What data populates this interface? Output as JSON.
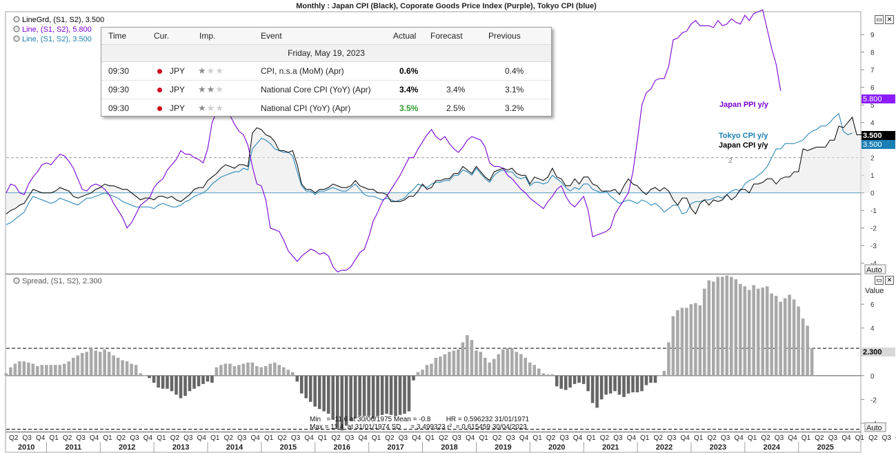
{
  "title": "Monthly : Japan CPI (Black), Coporate Goods Price Index (Purple), Tokyo CPI (blue)",
  "top_legend": [
    {
      "label": "LineGrd, (S1, S2), 3.500",
      "color": "#000000"
    },
    {
      "label": "Line, (S1, S2), 5.800",
      "color": "#7b00d6"
    },
    {
      "label": "Line, (S1, S2), 3.500",
      "color": "#1a7fb5"
    }
  ],
  "bottom_legend": "Spread, (S1, S2), 2.300",
  "value_label": "Value",
  "auto_label": "Auto",
  "series_labels": {
    "ppi": "Japan PPI y/y",
    "tokyo": "Tokyo CPI y/y",
    "japan": "Japan CPI y/y"
  },
  "badges": {
    "ppi": "5.800",
    "japan": "3.500",
    "tokyo": "3.500",
    "spread": "2.300"
  },
  "hline_label": "2",
  "stats": {
    "line1": "Min   = -11.6 at 30/06/1975 Mean = -0.8        HR = 0.596232 31/01/1971",
    "line2": "Max = 11.4  at 31/01/1974 SD     = 3.499323 r²  = 0.615459 30/04/2023"
  },
  "calendar": {
    "headers": [
      "Time",
      "Cur.",
      "Imp.",
      "Event",
      "Actual",
      "Forecast",
      "Previous"
    ],
    "date": "Friday, May 19, 2023",
    "rows": [
      {
        "time": "09:30",
        "cur": "JPY",
        "stars": 1,
        "event": "CPI, n.s.a (MoM) (Apr)",
        "actual": "0.6%",
        "actual_color": "#000000",
        "forecast": "",
        "previous": "0.4%"
      },
      {
        "time": "09:30",
        "cur": "JPY",
        "stars": 2,
        "event": "National Core CPI (YoY) (Apr)",
        "actual": "3.4%",
        "actual_color": "#000000",
        "forecast": "3.4%",
        "previous": "3.1%"
      },
      {
        "time": "09:30",
        "cur": "JPY",
        "stars": 1,
        "event": "National CPI (YoY) (Apr)",
        "actual": "3.5%",
        "actual_color": "#2e9e2e",
        "forecast": "2.5%",
        "previous": "3.2%"
      }
    ]
  },
  "colors": {
    "japan": "#000000",
    "ppi": "#7b00d6",
    "tokyo": "#1a7fb5",
    "bar": "#a9a9a9",
    "bar_neg": "#666666",
    "ppi_badge": "#8a1cff",
    "tokyo_badge": "#1a7fb5"
  },
  "chart_data": [
    {
      "type": "line",
      "y_ticks": [
        -4,
        -3,
        -2,
        -1,
        0,
        1,
        2,
        3,
        4,
        5,
        6,
        7,
        8,
        9
      ],
      "ylim": [
        -4.6,
        10.3
      ],
      "x_start": "2010-04",
      "series": [
        {
          "name": "Japan CPI y/y",
          "values": [
            -1.2,
            -1.0,
            -0.9,
            -0.7,
            -0.6,
            -0.2,
            0.2,
            0.1,
            0.0,
            0.0,
            0.0,
            0.1,
            0.3,
            0.2,
            0.1,
            -0.2,
            -0.3,
            -0.2,
            -0.1,
            0.0,
            0.2,
            0.3,
            0.5,
            0.4,
            0.4,
            0.3,
            0.2,
            0.2,
            0.0,
            -0.2,
            -0.4,
            -0.3,
            -0.3,
            -0.4,
            -0.2,
            -0.2,
            -0.3,
            -0.2,
            -0.4,
            -0.5,
            -0.3,
            -0.1,
            0.2,
            0.3,
            0.3,
            0.7,
            0.9,
            1.1,
            1.4,
            1.6,
            1.5,
            1.4,
            1.6,
            1.6,
            1.5,
            3.4,
            3.7,
            3.6,
            3.3,
            3.2,
            2.9,
            2.4,
            2.4,
            2.3,
            2.4,
            1.6,
            0.5,
            0.2,
            0.2,
            0.0,
            0.2,
            0.2,
            0.3,
            0.5,
            0.4,
            0.3,
            0.3,
            0.4,
            0.7,
            0.4,
            0.3,
            0.2,
            0.2,
            0.0,
            0.0,
            -0.1,
            -0.5,
            -0.5,
            -0.5,
            -0.4,
            -0.2,
            -0.2,
            0.1,
            0.5,
            0.2,
            0.3,
            0.7,
            0.7,
            0.8,
            0.8,
            1.1,
            1.1,
            1.5,
            1.3,
            1.1,
            1.5,
            1.2,
            0.9,
            0.7,
            1.2,
            1.3,
            1.4,
            1.3,
            1.4,
            1.1,
            1.0,
            1.0,
            0.5,
            0.9,
            0.8,
            0.7,
            0.9,
            1.4,
            0.9,
            0.8,
            0.4,
            0.4,
            0.8,
            0.5,
            0.9,
            0.9,
            0.5,
            0.4,
            0.1,
            0.1,
            0.1,
            0.2,
            -0.1,
            0.4,
            0.8,
            0.5,
            0.4,
            0.1,
            -0.1,
            0.2,
            0.3,
            0.1,
            0.3,
            0.1,
            -0.4,
            -0.7,
            -0.3,
            -0.3,
            -0.9,
            -1.2,
            -0.6,
            -0.4,
            -0.7,
            -0.4,
            -0.5,
            -0.4,
            -0.1,
            -0.4,
            -0.2,
            0.2,
            0.2,
            0.0,
            0.5,
            0.5,
            0.6,
            0.8,
            0.8,
            0.5,
            0.8,
            0.9,
            0.9,
            1.2,
            1.2,
            2.5,
            2.4,
            2.5,
            2.6,
            2.6,
            2.6,
            3.0,
            3.0,
            3.8,
            3.7,
            4.0,
            4.3,
            3.3,
            3.3,
            3.2,
            3.5
          ]
        },
        {
          "name": "Japan PPI y/y",
          "values": [
            0.0,
            0.5,
            0.4,
            0.0,
            -0.1,
            0.5,
            0.9,
            1.2,
            1.6,
            1.7,
            1.6,
            1.9,
            2.2,
            2.1,
            1.8,
            1.4,
            0.8,
            0.2,
            0.1,
            0.4,
            0.5,
            0.4,
            0.2,
            -0.1,
            -0.6,
            -1.0,
            -1.4,
            -2.0,
            -1.7,
            -1.2,
            -0.7,
            -0.5,
            -0.3,
            0.3,
            0.6,
            0.8,
            1.3,
            1.6,
            1.9,
            2.4,
            2.2,
            2.2,
            2.0,
            1.9,
            1.7,
            2.5,
            4.0,
            4.6,
            4.6,
            4.5,
            4.4,
            3.9,
            3.5,
            3.3,
            2.7,
            1.5,
            0.5,
            0.4,
            -0.4,
            -2.0,
            -2.1,
            -2.2,
            -2.7,
            -3.3,
            -3.6,
            -3.9,
            -3.6,
            -3.4,
            -3.2,
            -3.3,
            -3.5,
            -3.4,
            -3.6,
            -4.2,
            -4.5,
            -4.4,
            -4.4,
            -4.2,
            -3.8,
            -3.4,
            -3.2,
            -2.5,
            -1.6,
            -1.1,
            -0.5,
            -0.2,
            0.2,
            0.6,
            1.0,
            1.5,
            2.0,
            2.0,
            2.5,
            2.9,
            3.3,
            3.6,
            3.2,
            3.0,
            3.2,
            2.8,
            2.5,
            2.3,
            2.6,
            3.0,
            3.2,
            3.1,
            3.0,
            2.6,
            1.7,
            1.5,
            1.5,
            1.4,
            1.0,
            0.8,
            0.5,
            0.2,
            0.0,
            -0.3,
            -0.5,
            -0.7,
            -0.9,
            -0.5,
            -0.2,
            0.2,
            0.4,
            -0.2,
            -0.6,
            -0.8,
            -0.5,
            -0.2,
            -1.0,
            -2.5,
            -2.4,
            -2.3,
            -2.2,
            -2.0,
            -1.2,
            -0.8,
            -0.4,
            0.0,
            1.2,
            3.0,
            5.0,
            5.7,
            5.9,
            6.4,
            6.5,
            6.5,
            7.2,
            8.7,
            8.8,
            9.1,
            9.2,
            9.6,
            9.8,
            9.5,
            9.5,
            9.5,
            9.4,
            9.8,
            9.5,
            9.6,
            9.9,
            9.7,
            9.6,
            10.1,
            9.8,
            10.2,
            10.3,
            10.4,
            9.3,
            8.2,
            7.3,
            5.8
          ]
        },
        {
          "name": "Tokyo CPI y/y",
          "values": [
            -1.8,
            -1.7,
            -1.5,
            -1.3,
            -1.1,
            -0.6,
            -0.2,
            -0.3,
            -0.4,
            -0.5,
            -0.6,
            -0.5,
            -0.3,
            -0.4,
            -0.5,
            -0.6,
            -0.7,
            -0.5,
            -0.3,
            -0.3,
            -0.2,
            -0.1,
            0.0,
            -0.1,
            -0.2,
            -0.3,
            -0.5,
            -0.6,
            -0.7,
            -0.8,
            -0.8,
            -0.8,
            -0.8,
            -0.9,
            -0.7,
            -0.6,
            -0.7,
            -0.8,
            -0.8,
            -0.7,
            -0.5,
            -0.4,
            -0.2,
            -0.1,
            0.0,
            0.2,
            0.5,
            0.7,
            0.9,
            1.0,
            1.1,
            1.2,
            1.2,
            1.4,
            1.3,
            2.5,
            2.8,
            3.1,
            3.0,
            2.8,
            2.5,
            2.4,
            2.3,
            2.3,
            2.1,
            1.2,
            0.4,
            0.1,
            0.1,
            -0.1,
            0.1,
            0.1,
            0.2,
            0.3,
            0.2,
            0.1,
            0.1,
            0.3,
            0.5,
            0.2,
            -0.1,
            -0.2,
            -0.2,
            -0.3,
            -0.4,
            -0.3,
            -0.4,
            -0.5,
            -0.4,
            -0.3,
            0.0,
            0.2,
            0.5,
            0.4,
            0.3,
            0.5,
            0.6,
            0.6,
            0.7,
            0.7,
            1.0,
            1.0,
            1.3,
            1.2,
            1.0,
            1.4,
            1.1,
            0.8,
            0.6,
            1.0,
            1.2,
            1.3,
            1.2,
            1.2,
            0.9,
            0.8,
            0.9,
            0.4,
            0.6,
            0.6,
            0.5,
            0.6,
            1.0,
            0.8,
            0.6,
            0.3,
            0.1,
            0.3,
            0.2,
            0.5,
            0.5,
            0.2,
            0.1,
            0.0,
            0.1,
            -0.2,
            -0.4,
            -0.6,
            -0.5,
            -0.4,
            -0.5,
            -0.6,
            -0.4,
            -0.5,
            -0.7,
            -0.6,
            -0.8,
            -1.1,
            -0.9,
            -0.7,
            -0.7,
            -1.2,
            -1.1,
            -0.6,
            -0.5,
            -0.5,
            -0.4,
            -0.4,
            -0.3,
            -0.2,
            -0.3,
            -0.1,
            0.1,
            0.2,
            0.1,
            0.5,
            0.7,
            0.8,
            1.0,
            1.2,
            1.5,
            2.0,
            2.5,
            2.5,
            2.8,
            2.8,
            2.8,
            2.9,
            3.0,
            3.3,
            3.5,
            3.6,
            3.8,
            3.8,
            4.0,
            4.3,
            4.5,
            3.5,
            3.3,
            3.4
          ]
        }
      ],
      "annotations": [
        "Japan PPI y/y",
        "Tokyo CPI y/y",
        "Japan CPI y/y"
      ]
    },
    {
      "type": "bar",
      "name": "Spread, (S1, S2)",
      "y_ticks": [
        -4,
        -2,
        0,
        2,
        4,
        6
      ],
      "ylim": [
        -4.7,
        8.5
      ],
      "x_start": "2010-04",
      "reference_line": 2.3,
      "values": [
        0.2,
        0.7,
        1.0,
        1.2,
        1.2,
        1.1,
        1.0,
        0.8,
        0.9,
        0.9,
        0.9,
        0.9,
        0.9,
        1.0,
        1.2,
        1.5,
        1.7,
        1.9,
        2.0,
        2.3,
        2.1,
        2.0,
        2.2,
        2.0,
        1.7,
        1.5,
        1.3,
        1.2,
        1.0,
        0.9,
        0.2,
        0.0,
        -0.2,
        -0.6,
        -1.0,
        -1.1,
        -1.1,
        -1.3,
        -1.6,
        -1.9,
        -1.7,
        -1.3,
        -1.1,
        -0.9,
        -0.7,
        -0.5,
        -0.6,
        0.7,
        0.9,
        1.0,
        1.0,
        0.8,
        0.9,
        1.0,
        1.1,
        1.1,
        0.8,
        0.7,
        0.8,
        1.0,
        1.1,
        0.9,
        0.7,
        0.5,
        0.3,
        -0.5,
        -1.5,
        -1.9,
        -2.2,
        -2.6,
        -2.8,
        -3.0,
        -3.2,
        -3.7,
        -4.4,
        -4.6,
        -4.2,
        -3.8,
        -3.6,
        -3.4,
        -3.4,
        -3.4,
        -3.6,
        -3.4,
        -3.3,
        -3.2,
        -3.3,
        -3.4,
        -3.3,
        -3.2,
        -3.0,
        -0.4,
        0.3,
        0.5,
        0.9,
        1.0,
        1.5,
        1.6,
        1.8,
        2.0,
        2.1,
        2.2,
        2.8,
        3.4,
        3.0,
        2.1,
        2.0,
        1.5,
        1.1,
        1.4,
        1.8,
        2.2,
        2.3,
        2.3,
        2.0,
        1.8,
        1.5,
        1.1,
        0.9,
        0.6,
        0.2,
        0.1,
        0.1,
        -0.9,
        -1.1,
        -1.2,
        -1.0,
        -0.7,
        -0.6,
        -0.7,
        -1.3,
        -2.3,
        -2.7,
        -2.0,
        -1.6,
        -1.5,
        -1.3,
        -1.6,
        -1.8,
        -1.5,
        -1.4,
        -1.4,
        -1.3,
        -0.8,
        -0.6,
        -0.6,
        0.0,
        0.4,
        2.8,
        5.0,
        5.5,
        5.7,
        5.7,
        6.0,
        6.1,
        5.9,
        7.3,
        8.0,
        7.9,
        8.3,
        8.3,
        8.4,
        8.3,
        8.1,
        7.7,
        7.5,
        7.2,
        7.6,
        7.3,
        7.4,
        7.5,
        6.9,
        6.7,
        6.2,
        6.5,
        6.8,
        6.4,
        5.8,
        4.8,
        4.2,
        2.3
      ]
    }
  ],
  "x_axis": {
    "quarters": [
      "Q2",
      "Q3",
      "Q4",
      "Q1",
      "Q2",
      "Q3",
      "Q4",
      "Q1",
      "Q2",
      "Q3",
      "Q4",
      "Q1",
      "Q2",
      "Q3",
      "Q4",
      "Q1",
      "Q2",
      "Q3",
      "Q4",
      "Q1",
      "Q2",
      "Q3",
      "Q4",
      "Q1",
      "Q2",
      "Q3",
      "Q4",
      "Q1",
      "Q2",
      "Q3",
      "Q4",
      "Q1",
      "Q2",
      "Q3",
      "Q4",
      "Q1",
      "Q2",
      "Q3",
      "Q4",
      "Q1",
      "Q2",
      "Q3",
      "Q4",
      "Q1",
      "Q2",
      "Q3",
      "Q4",
      "Q1",
      "Q2",
      "Q3",
      "Q4",
      "Q1",
      "Q2",
      "Q3",
      "Q4",
      "Q1",
      "Q2",
      "Q3",
      "Q4",
      "Q1",
      "Q2",
      "Q3",
      "Q4",
      "Q1",
      "Q2",
      "Q3",
      "Q4"
    ],
    "years": [
      "2010",
      "2011",
      "2012",
      "2013",
      "2014",
      "2015",
      "2016",
      "2017",
      "2018",
      "2019",
      "2020",
      "2021",
      "2022",
      "2023",
      "2024",
      "2025"
    ]
  }
}
